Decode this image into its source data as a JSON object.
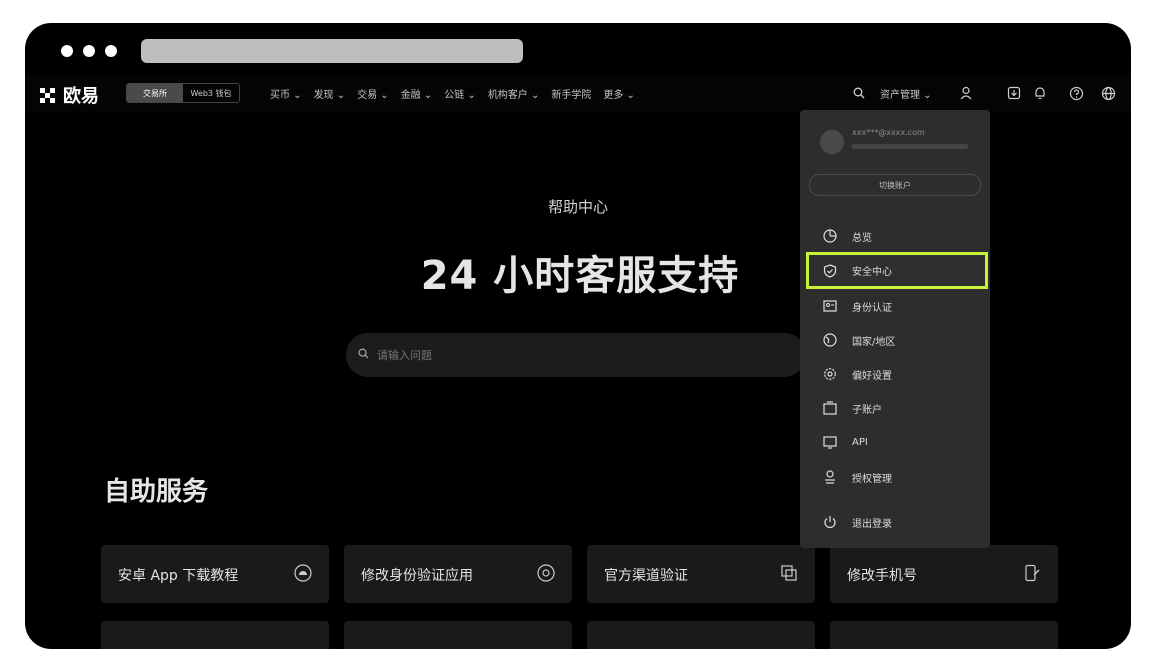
{
  "navbar": {
    "brand": "欧易",
    "mode_tabs": [
      "交易所",
      "Web3 钱包"
    ],
    "links": [
      "买币 ⌄",
      "发现 ⌄",
      "交易 ⌄",
      "金融 ⌄",
      "公链 ⌄",
      "机构客户 ⌄",
      "新手学院",
      "更多 ⌄"
    ],
    "assets": "资产管理 ⌄",
    "icons": [
      "search-icon",
      "user-icon",
      "download-icon",
      "bell-icon",
      "help-icon",
      "globe-icon"
    ]
  },
  "hero": {
    "subtitle": "帮助中心",
    "title": "24 小时客服支持",
    "search_placeholder": "请输入问题"
  },
  "self_service": {
    "title": "自助服务",
    "cards": [
      {
        "label": "安卓 App 下载教程",
        "icon": "android-icon"
      },
      {
        "label": "修改身份验证应用",
        "icon": "authenticator-icon"
      },
      {
        "label": "官方渠道验证",
        "icon": "verify-icon"
      },
      {
        "label": "修改手机号",
        "icon": "phone-edit-icon"
      }
    ]
  },
  "dropdown": {
    "account_email": "xxx***@xxxx.com",
    "switch_label": "切换账户",
    "items": [
      {
        "label": "总览",
        "icon": "overview-icon"
      },
      {
        "label": "安全中心",
        "icon": "shield-icon"
      },
      {
        "label": "身份认证",
        "icon": "id-card-icon"
      },
      {
        "label": "国家/地区",
        "icon": "region-icon"
      },
      {
        "label": "偏好设置",
        "icon": "gear-icon"
      },
      {
        "label": "子账户",
        "icon": "sub-account-icon"
      },
      {
        "label": "API",
        "icon": "api-icon"
      },
      {
        "label": "授权管理",
        "icon": "authorization-icon"
      },
      {
        "label": "退出登录",
        "icon": "logout-icon"
      }
    ],
    "highlight_color": "#c6f339"
  }
}
